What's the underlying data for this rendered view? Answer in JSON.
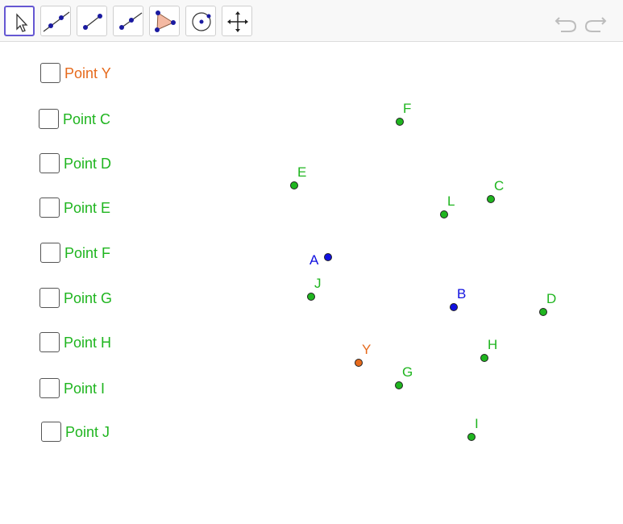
{
  "toolbar": {
    "tools": [
      {
        "icon": "arrow-pointer-icon"
      },
      {
        "icon": "line-through-points-icon"
      },
      {
        "icon": "segment-icon"
      },
      {
        "icon": "ray-icon"
      },
      {
        "icon": "polygon-icon"
      },
      {
        "icon": "circle-center-point-icon"
      },
      {
        "icon": "move-graphics-view-icon"
      }
    ],
    "undo_icon": "undo-icon",
    "redo_icon": "redo-icon",
    "accent": "#6557d2"
  },
  "checkboxes": [
    {
      "label": "Point Y",
      "color": "#e66a1c",
      "checked": false
    },
    {
      "label": "Point C",
      "color": "#1fb51f",
      "checked": false
    },
    {
      "label": "Point D",
      "color": "#1fb51f",
      "checked": false
    },
    {
      "label": "Point E",
      "color": "#1fb51f",
      "checked": false
    },
    {
      "label": "Point F",
      "color": "#1fb51f",
      "checked": false
    },
    {
      "label": "Point G",
      "color": "#1fb51f",
      "checked": false
    },
    {
      "label": "Point H",
      "color": "#1fb51f",
      "checked": false
    },
    {
      "label": "Point I",
      "color": "#1fb51f",
      "checked": false
    },
    {
      "label": "Point J",
      "color": "#1fb51f",
      "checked": false
    }
  ],
  "points": [
    {
      "name": "F",
      "color": "#1fb51f"
    },
    {
      "name": "E",
      "color": "#1fb51f"
    },
    {
      "name": "C",
      "color": "#1fb51f"
    },
    {
      "name": "L",
      "color": "#1fb51f"
    },
    {
      "name": "A",
      "color": "#1010e0"
    },
    {
      "name": "J",
      "color": "#1fb51f"
    },
    {
      "name": "B",
      "color": "#1010e0"
    },
    {
      "name": "D",
      "color": "#1fb51f"
    },
    {
      "name": "Y",
      "color": "#e66a1c"
    },
    {
      "name": "H",
      "color": "#1fb51f"
    },
    {
      "name": "G",
      "color": "#1fb51f"
    },
    {
      "name": "I",
      "color": "#1fb51f"
    }
  ]
}
